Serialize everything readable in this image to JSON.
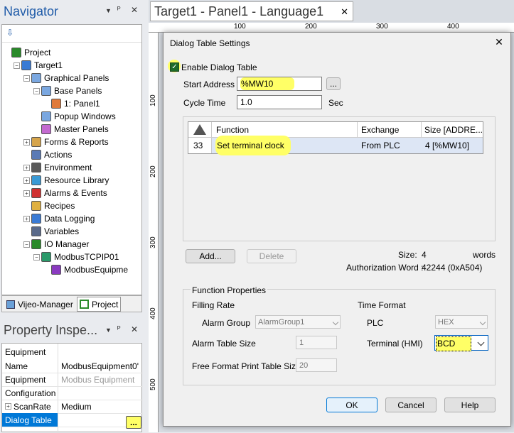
{
  "navigator": {
    "title": "Navigator",
    "tree": [
      {
        "label": "Project"
      },
      {
        "label": "Target1"
      },
      {
        "label": "Graphical Panels"
      },
      {
        "label": "Base Panels"
      },
      {
        "label": "1: Panel1"
      },
      {
        "label": "Popup Windows"
      },
      {
        "label": "Master Panels"
      },
      {
        "label": "Forms & Reports"
      },
      {
        "label": "Actions"
      },
      {
        "label": "Environment"
      },
      {
        "label": "Resource Library"
      },
      {
        "label": "Alarms & Events"
      },
      {
        "label": "Recipes"
      },
      {
        "label": "Data Logging"
      },
      {
        "label": "Variables"
      },
      {
        "label": "IO Manager"
      },
      {
        "label": "ModbusTCPIP01"
      },
      {
        "label": "ModbusEquipme"
      }
    ],
    "tabs": [
      "Vijeo-Manager",
      "Project"
    ]
  },
  "inspector": {
    "title": "Property Inspe...",
    "header": "Equipment",
    "rows": [
      {
        "key": "Name",
        "value": "ModbusEquipment0'"
      },
      {
        "key": "Equipment",
        "value": "Modbus Equipment"
      },
      {
        "key": "Configuration",
        "value": ""
      },
      {
        "key": "ScanRate",
        "value": "Medium"
      },
      {
        "key": "Dialog Table",
        "value": ""
      }
    ],
    "ellipsis": "..."
  },
  "editor": {
    "tab_title": "Target1 - Panel1 - Language1",
    "ruler_h": [
      "100",
      "200",
      "300",
      "400"
    ],
    "ruler_v": [
      "100",
      "200",
      "300",
      "400",
      "500"
    ]
  },
  "dialog": {
    "title": "Dialog Table Settings",
    "enable_label": "Enable Dialog Table",
    "start_address_label": "Start Address",
    "start_address_value": "%MW10",
    "browse": "...",
    "cycle_time_label": "Cycle Time",
    "cycle_time_value": "1.0",
    "cycle_unit": "Sec",
    "table": {
      "headers": [
        "Function",
        "Exchange",
        "Size [ADDRE..."
      ],
      "rows": [
        {
          "num": "33",
          "function": "Set terminal clock",
          "exchange": "From PLC",
          "size": "4 [%MW10]"
        }
      ]
    },
    "add_label": "Add...",
    "delete_label": "Delete",
    "size_label": "Size:",
    "size_value": "4",
    "size_unit": "words",
    "auth_label": "Authorization Word :",
    "auth_value": "42244 (0xA504)",
    "fp_title": "Function Properties",
    "filling_rate": "Filling Rate",
    "alarm_group_label": "Alarm Group",
    "alarm_group_value": "AlarmGroup1",
    "alarm_table_size_label": "Alarm Table Size",
    "alarm_table_size_value": "1",
    "free_format_label": "Free Format Print Table Size",
    "free_format_value": "20",
    "time_format": "Time Format",
    "plc_label": "PLC",
    "plc_value": "HEX",
    "terminal_label": "Terminal (HMI)",
    "terminal_value": "BCD",
    "ok": "OK",
    "cancel": "Cancel",
    "help": "Help",
    "close": "✕"
  }
}
